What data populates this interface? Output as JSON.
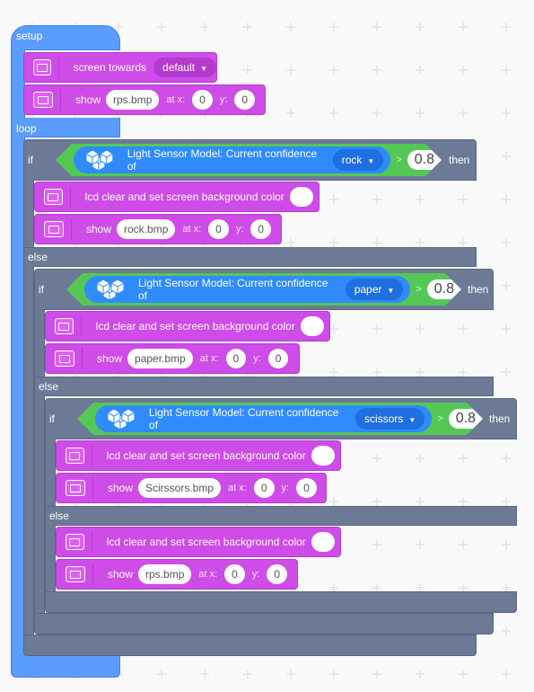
{
  "setup": {
    "label": "setup"
  },
  "loop": {
    "label": "loop"
  },
  "screen_towards": {
    "text": "screen towards",
    "option": "default"
  },
  "show1": {
    "text": "show",
    "file": "rps.bmp",
    "at_x": "at x:",
    "x": "0",
    "y_label": "y:",
    "y": "0"
  },
  "if_label": "if",
  "else_label": "else",
  "then_label": "then",
  "sensor_text": "Light Sensor Model: Current confidence of",
  "gt": ">",
  "cond1": {
    "option": "rock",
    "value": "0.8"
  },
  "cond2": {
    "option": "paper",
    "value": "0.8"
  },
  "cond3": {
    "option": "scissors",
    "value": "0.8"
  },
  "lcd_text": "lcd clear and set screen background color",
  "show_rock": {
    "text": "show",
    "file": "rock.bmp",
    "at_x": "at x:",
    "x": "0",
    "y_label": "y:",
    "y": "0"
  },
  "show_paper": {
    "text": "show",
    "file": "paper.bmp",
    "at_x": "at x:",
    "x": "0",
    "y_label": "y:",
    "y": "0"
  },
  "show_scissors": {
    "text": "show",
    "file": "Scirssors.bmp",
    "at_x": "at x:",
    "x": "0",
    "y_label": "y:",
    "y": "0"
  },
  "show_rps": {
    "text": "show",
    "file": "rps.bmp",
    "at_x": "at x:",
    "x": "0",
    "y_label": "y:",
    "y": "0"
  },
  "colors": {
    "control": "#6c7a96",
    "event": "#5b9cff",
    "display": "#ce4ce8",
    "operator": "#55c755",
    "sensor": "#2f8bff"
  }
}
